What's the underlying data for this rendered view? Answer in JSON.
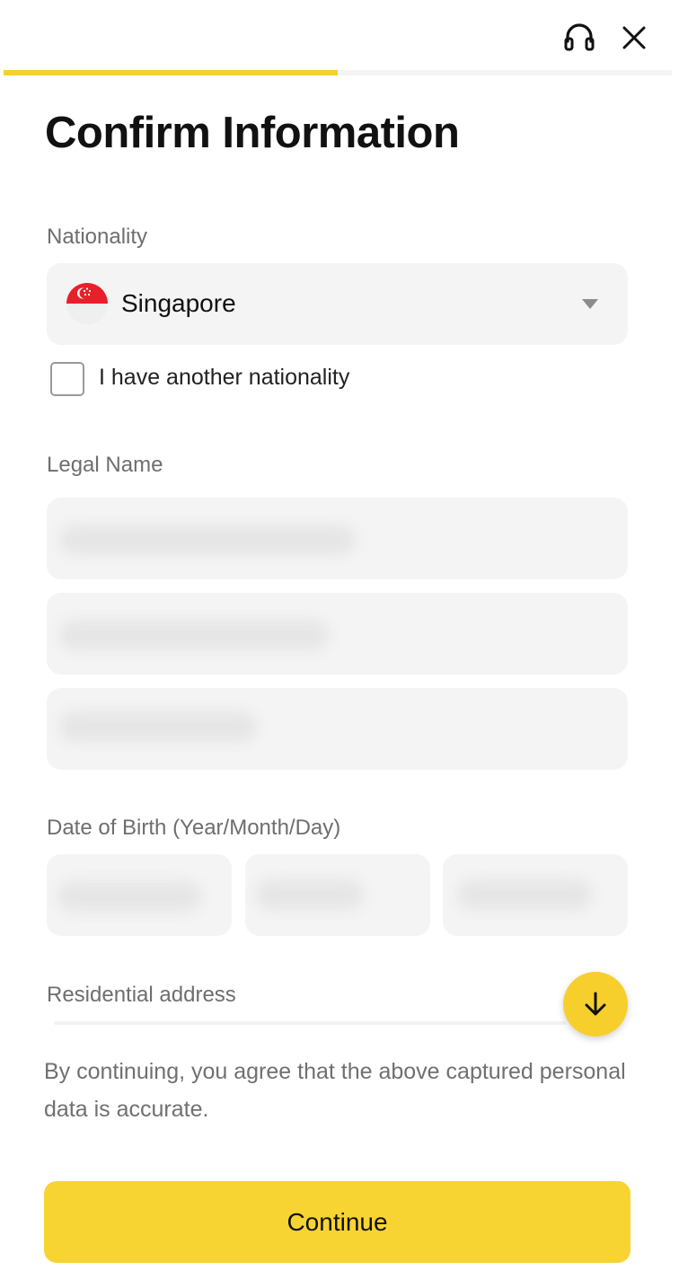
{
  "header": {
    "support_icon": "headset-icon",
    "close_icon": "close-icon",
    "progress": 0.5
  },
  "title": "Confirm Information",
  "nationality": {
    "label": "Nationality",
    "value": "Singapore",
    "flag_icon": "singapore-flag-icon",
    "another_nationality_label": "I have another nationality",
    "another_nationality_checked": false
  },
  "legal_name": {
    "label": "Legal Name"
  },
  "dob": {
    "label": "Date of Birth (Year/Month/Day)"
  },
  "address": {
    "label": "Residential address",
    "scroll_icon": "arrow-down-icon"
  },
  "disclaimer": "By continuing, you agree that the above captured personal data is accurate.",
  "continue_label": "Continue",
  "colors": {
    "accent": "#f7d432",
    "field_bg": "#f4f4f4",
    "label": "#6e6e6e"
  }
}
